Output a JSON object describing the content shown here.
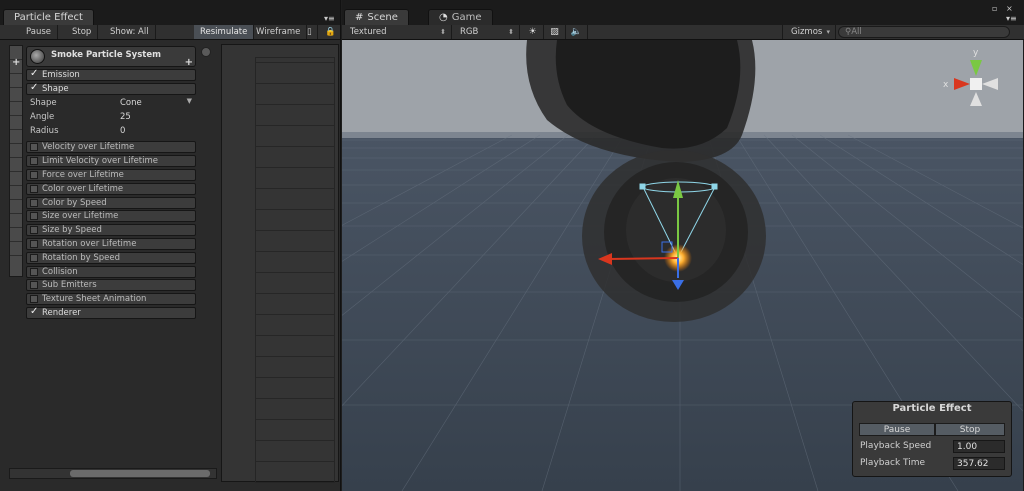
{
  "particle_panel": {
    "tab_title": "Particle Effect",
    "toolbar": {
      "pause": "Pause",
      "stop": "Stop",
      "show": "Show: All",
      "resimulate": "Resimulate",
      "wireframe": "Wireframe"
    },
    "system_name": "Smoke Particle System",
    "modules": [
      {
        "label": "Emission",
        "checked": true
      },
      {
        "label": "Shape",
        "checked": true
      }
    ],
    "shape_props": [
      {
        "name": "Shape",
        "value": "Cone"
      },
      {
        "name": "Angle",
        "value": "25"
      },
      {
        "name": "Radius",
        "value": "0"
      }
    ],
    "more_modules": [
      {
        "label": "Velocity over Lifetime",
        "checked": false
      },
      {
        "label": "Limit Velocity over Lifetime",
        "checked": false
      },
      {
        "label": "Force over Lifetime",
        "checked": false
      },
      {
        "label": "Color over Lifetime",
        "checked": false
      },
      {
        "label": "Color by Speed",
        "checked": false
      },
      {
        "label": "Size over Lifetime",
        "checked": false
      },
      {
        "label": "Size by Speed",
        "checked": false
      },
      {
        "label": "Rotation over Lifetime",
        "checked": false
      },
      {
        "label": "Rotation by Speed",
        "checked": false
      },
      {
        "label": "Collision",
        "checked": false
      },
      {
        "label": "Sub Emitters",
        "checked": false
      },
      {
        "label": "Texture Sheet Animation",
        "checked": false
      },
      {
        "label": "Renderer",
        "checked": true
      }
    ]
  },
  "scene_panel": {
    "tabs": [
      {
        "label": "Scene"
      },
      {
        "label": "Game"
      }
    ],
    "toolbar": {
      "render_mode": "Textured",
      "color_mode": "RGB",
      "gizmos": "Gizmos",
      "search_placeholder": "All"
    },
    "gizmo_axes": {
      "y": "y",
      "x": "x"
    }
  },
  "playback": {
    "title": "Particle Effect",
    "pause": "Pause",
    "stop": "Stop",
    "speed_label": "Playback Speed",
    "speed_value": "1.00",
    "time_label": "Playback Time",
    "time_value": "357.62"
  },
  "colors": {
    "axis_x": "#d9361e",
    "axis_y": "#7ac843",
    "axis_z": "#3a6fe6",
    "gizmo_cone": "#8fd6e8"
  }
}
